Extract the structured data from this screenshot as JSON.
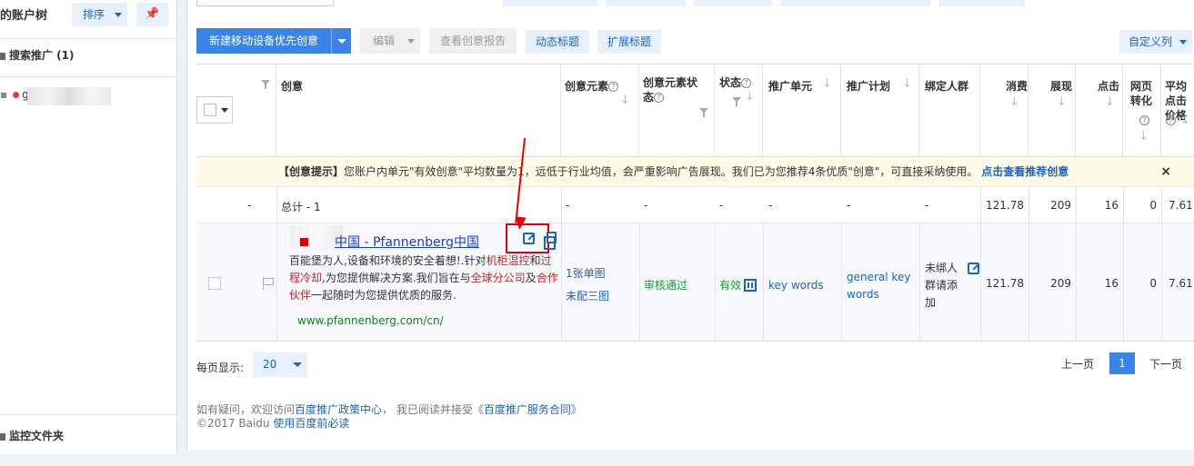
{
  "sidebar": {
    "title": "的账户树",
    "sort_label": "排序",
    "pin_icon": "pin-icon",
    "section_label": "搜索推广 (1)",
    "account_prefix": "g",
    "monitor_label": "监控文件夹"
  },
  "toolbar": {
    "new_label": "新建移动设备优先创意",
    "edit_label": "编辑",
    "report_label": "查看创意报告",
    "dynamic_title_label": "动态标题",
    "extend_title_label": "扩展标题",
    "custom_columns_label": "自定义列"
  },
  "columns": {
    "creative": "创意",
    "elements": "创意元素",
    "element_status": "创意元素状态",
    "status": "状态",
    "unit": "推广单元",
    "plan": "推广计划",
    "audience": "绑定人群",
    "cost": "消费",
    "impressions": "展现",
    "clicks": "点击",
    "conversion": "网页转化",
    "avg_cpc": "平均点击价格"
  },
  "tip": {
    "prefix": "【创意提示】",
    "text": "您账户内单元\"有效创意\"平均数量为1，远低于行业均值，会严重影响广告展现。我们已为您推荐4条优质\"创意\"，可直接采纳使用。",
    "link": "点击查看推荐创意",
    "close": "×"
  },
  "total_row": {
    "dash": "-",
    "label": "总计 - 1",
    "elements": "-",
    "element_status": "-",
    "status": "-",
    "unit": "-",
    "plan": "-",
    "audience": "-",
    "cost": "121.78",
    "impressions": "209",
    "clicks": "16",
    "conversion": "0",
    "avg_cpc": "7.61"
  },
  "data_row": {
    "title": "中国 - Pfannenberg中国",
    "desc_1": "百能堡为人,设备和环境的安全着想!.针对",
    "desc_kw1": "机柜温控",
    "desc_2": "和",
    "desc_kw2": "过程冷却",
    "desc_3": ",为您提供解决方案.我们旨在与",
    "desc_kw3": "全球分公司",
    "desc_4": "及",
    "desc_kw4": "合作伙伴",
    "desc_5": "一起随时为您提供优质的服务.",
    "url": "www.pfannenberg.com/cn/",
    "elements_1": "1张单图",
    "elements_2": "未配三图",
    "element_status": "审核通过",
    "status": "有效",
    "unit": "key words",
    "plan": "general key words",
    "audience": "未绑人群请添加",
    "cost": "121.78",
    "impressions": "209",
    "clicks": "16",
    "conversion": "0",
    "avg_cpc": "7.61"
  },
  "pager": {
    "label": "每页显示:",
    "page_size": "20",
    "prev": "上一页",
    "current": "1",
    "next": "下一页"
  },
  "footer": {
    "line1_prefix": "如有疑问，欢迎访问",
    "policy_link": "百度推广政策中心",
    "line1_mid": "，  我已阅读并接受《",
    "contract_link": "百度推广服务合同",
    "line1_suffix": "》",
    "line2_prefix": "©2017 Baidu ",
    "must_read_link": "使用百度前必读"
  },
  "colors": {
    "accent": "#3a84e8",
    "link": "#1a64c8",
    "annotation": "#e00000"
  }
}
